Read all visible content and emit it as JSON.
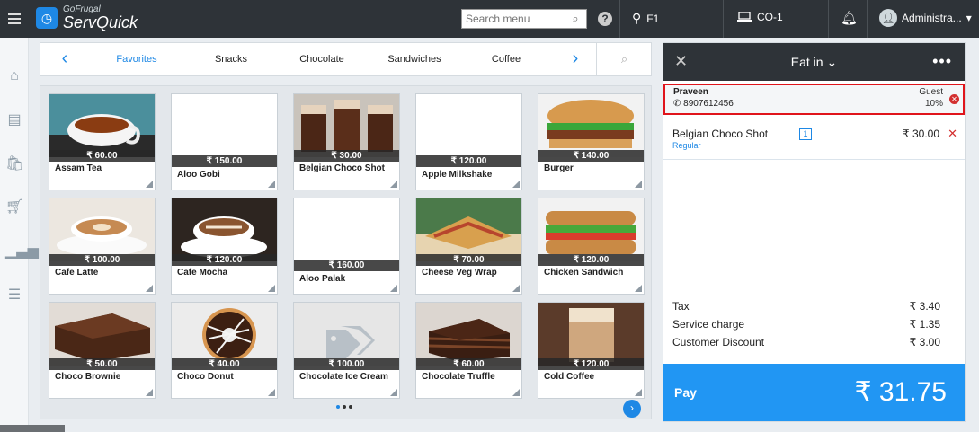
{
  "app": {
    "brand_small": "GoFrugal",
    "brand_big": "ServQuick"
  },
  "topbar": {
    "search_placeholder": "Search menu",
    "location": "F1",
    "counter": "CO-1",
    "user": "Administra..."
  },
  "categories": {
    "items": [
      "Favorites",
      "Snacks",
      "Chocolate",
      "Sandwiches",
      "Coffee"
    ],
    "active": "Favorites"
  },
  "products": [
    {
      "name": "Assam Tea",
      "price": "₹ 60.00",
      "img": "tea"
    },
    {
      "name": "Aloo Gobi",
      "price": "₹ 150.00",
      "img": "none"
    },
    {
      "name": "Belgian Choco Shot",
      "price": "₹ 30.00",
      "img": "chocoshot"
    },
    {
      "name": "Apple Milkshake",
      "price": "₹ 120.00",
      "img": "none"
    },
    {
      "name": "Burger",
      "price": "₹ 140.00",
      "img": "burger"
    },
    {
      "name": "Cafe Latte",
      "price": "₹ 100.00",
      "img": "latte"
    },
    {
      "name": "Cafe Mocha",
      "price": "₹ 120.00",
      "img": "mocha"
    },
    {
      "name": "Aloo Palak",
      "price": "₹ 160.00",
      "img": "none"
    },
    {
      "name": "Cheese Veg Wrap",
      "price": "₹ 70.00",
      "img": "wrap"
    },
    {
      "name": "Chicken Sandwich",
      "price": "₹ 120.00",
      "img": "sandwich"
    },
    {
      "name": "Choco Brownie",
      "price": "₹ 50.00",
      "img": "brownie"
    },
    {
      "name": "Choco Donut",
      "price": "₹ 40.00",
      "img": "donut"
    },
    {
      "name": "Chocolate Ice Cream",
      "price": "₹ 100.00",
      "img": "placeholder"
    },
    {
      "name": "Chocolate Truffle",
      "price": "₹ 60.00",
      "img": "truffle"
    },
    {
      "name": "Cold Coffee",
      "price": "₹ 120.00",
      "img": "coldcoffee"
    }
  ],
  "order": {
    "mode": "Eat in",
    "customer": {
      "name": "Praveen",
      "phone": "8907612456",
      "type": "Guest",
      "discount": "10%"
    },
    "items": [
      {
        "name": "Belgian Choco Shot",
        "variant": "Regular",
        "qty": "1",
        "price": "₹ 30.00"
      }
    ],
    "totals": {
      "tax_label": "Tax",
      "tax": "₹ 3.40",
      "service_label": "Service charge",
      "service": "₹ 1.35",
      "discount_label": "Customer Discount",
      "discount": "₹ 3.00"
    },
    "pay_label": "Pay",
    "pay_amount": "₹ 31.75"
  },
  "colors": {
    "accent": "#2196f3",
    "topbar": "#2e3338",
    "highlight": "#e0141b"
  }
}
